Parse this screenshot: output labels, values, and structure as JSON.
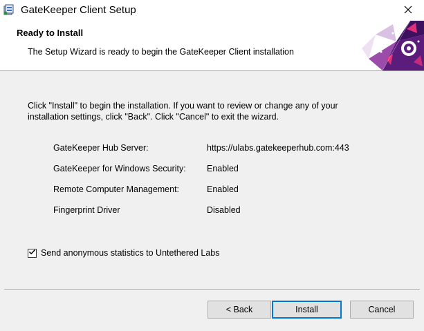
{
  "window": {
    "title": "GateKeeper Client Setup"
  },
  "banner": {
    "title": "Ready to Install",
    "subtitle": "The Setup Wizard is ready to begin the GateKeeper Client installation"
  },
  "instructions": {
    "line1": "Click \"Install\" to begin the installation.  If you want to review or change any of your",
    "line2": "installation settings, click \"Back\".  Click \"Cancel\" to exit the wizard."
  },
  "summary": [
    {
      "label": "GateKeeper Hub Server:",
      "value": "https://ulabs.gatekeeperhub.com:443"
    },
    {
      "label": "GateKeeper for Windows Security:",
      "value": "Enabled"
    },
    {
      "label": "Remote Computer Management:",
      "value": "Enabled"
    },
    {
      "label": "Fingerprint Driver",
      "value": "Disabled"
    }
  ],
  "statistics_checkbox": {
    "label": "Send anonymous statistics to Untethered Labs",
    "checked": true
  },
  "buttons": {
    "back": "< Back",
    "install": "Install",
    "cancel": "Cancel"
  },
  "colors": {
    "accent": "#0078d7",
    "banner_art_primary": "#5b1c7c",
    "banner_art_secondary": "#e0307a"
  },
  "icons": {
    "app": "installer-package-icon",
    "close": "close-icon",
    "check": "checkmark-icon"
  }
}
